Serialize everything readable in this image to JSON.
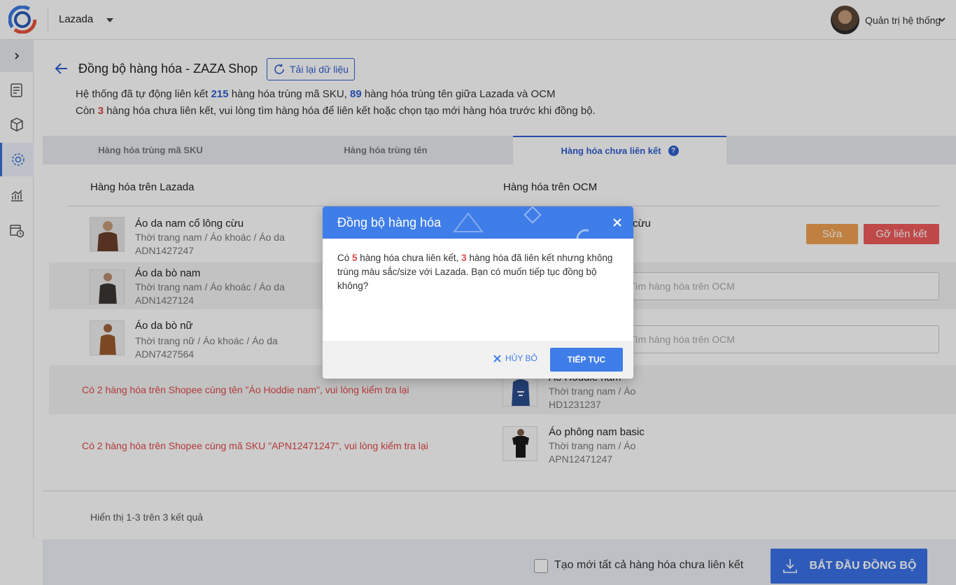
{
  "header": {
    "channel": "Lazada",
    "username": "Quản trị hệ thống"
  },
  "page": {
    "title": "Đồng bộ hàng hóa - ZAZA Shop",
    "reload_label": "Tải lại dữ liệu",
    "summary_1_prefix": "Hệ thống đã tự động liên kết ",
    "summary_1_sku_count": "215",
    "summary_1_mid": " hàng hóa trùng mã SKU, ",
    "summary_1_name_count": "89",
    "summary_1_suffix": " hàng hóa trùng tên giữa Lazada và OCM",
    "summary_2_prefix": "Còn ",
    "summary_2_count": "3",
    "summary_2_suffix": " hàng hóa chưa liên kết, vui lòng tìm hàng hóa để liên kết hoặc chọn tạo mới hàng hóa trước khi đồng bộ."
  },
  "tabs": [
    {
      "label": "Hàng hóa trùng mã SKU"
    },
    {
      "label": "Hàng hóa trùng tên"
    },
    {
      "label": "Hàng hóa chưa liên kết",
      "help": "?"
    }
  ],
  "table": {
    "col_left": "Hàng hóa trên Lazada",
    "col_right": "Hàng hóa trên OCM",
    "rows": [
      {
        "name": "Áo da nam cổ lông cừu",
        "category": "Thời trang nam / Áo khoác / Áo da",
        "sku": "ADN1427247",
        "ocm_name_tail": "cừu"
      },
      {
        "name": "Áo da bò nam",
        "category": "Thời trang nam / Áo khoác / Áo da",
        "sku": "ADN1427124",
        "search_placeholder": "Tìm hàng hóa trên OCM"
      },
      {
        "name": "Áo da bò nữ",
        "category": "Thời trang nữ / Áo khoác / Áo da",
        "sku": "ADN7427564",
        "search_placeholder": "Tìm hàng hóa trên OCM"
      }
    ],
    "edit_label": "Sửa",
    "unlink_label": "Gỡ liên kết",
    "warnings": [
      {
        "text": "Có 2 hàng hóa trên Shopee cùng tên \"Áo Hoddie nam\", vui lòng kiểm tra lại",
        "ocm_name": "Áo Hoddie nam",
        "ocm_category": "Thời trang nam / Áo",
        "ocm_sku": "HD1231237"
      },
      {
        "text": "Có 2 hàng hóa trên Shopee cùng mã SKU \"APN12471247\", vui lòng kiểm tra lại",
        "ocm_name": "Áo phông nam basic",
        "ocm_category": "Thời trang nam / Áo",
        "ocm_sku": "APN12471247"
      }
    ]
  },
  "pager": {
    "info": "Hiển thị 1-3 trên 3 kết quả"
  },
  "footer": {
    "create_all_label": "Tạo mới tất cả hàng hóa chưa liên kết",
    "sync_label": "BẮT ĐẦU ĐỒNG BỘ"
  },
  "modal": {
    "title": "Đồng bộ hàng hóa",
    "body_prefix": "Có ",
    "body_count1": "5",
    "body_mid": " hàng hóa chưa liên kết, ",
    "body_count2": "3",
    "body_suffix": " hàng hóa đã liên kết nhưng không trùng màu sắc/size với Lazada. Bạn có muốn tiếp tục đồng bộ không?",
    "cancel_label": "HỦY BỎ",
    "continue_label": "TIẾP TỤC"
  },
  "colors": {
    "accent": "#3f7de8",
    "danger": "#ef5a5a",
    "warning": "#f0a052"
  }
}
